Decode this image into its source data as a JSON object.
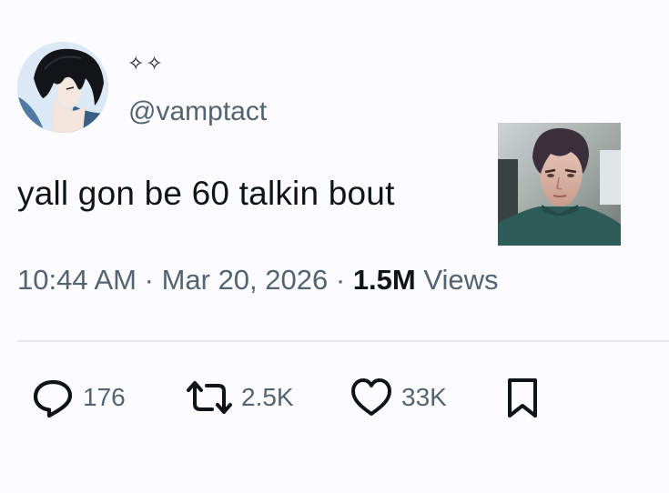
{
  "author": {
    "display_name": "✧✧",
    "handle": "@vamptact"
  },
  "tweet": {
    "text": "yall gon be 60 talkin bout"
  },
  "meta": {
    "time": "10:44 AM",
    "separator": "·",
    "date": "Mar 20, 2026",
    "views_count": "1.5M",
    "views_label": "Views"
  },
  "actions": {
    "replies": "176",
    "reposts": "2.5K",
    "likes": "33K"
  },
  "icons": {
    "reply": "reply-icon",
    "repost": "repost-icon",
    "like": "heart-icon",
    "bookmark": "bookmark-icon"
  },
  "colors": {
    "text": "#0f1419",
    "secondary": "#536471",
    "divider": "#e8e8ec",
    "background": "#fcfbfd"
  }
}
